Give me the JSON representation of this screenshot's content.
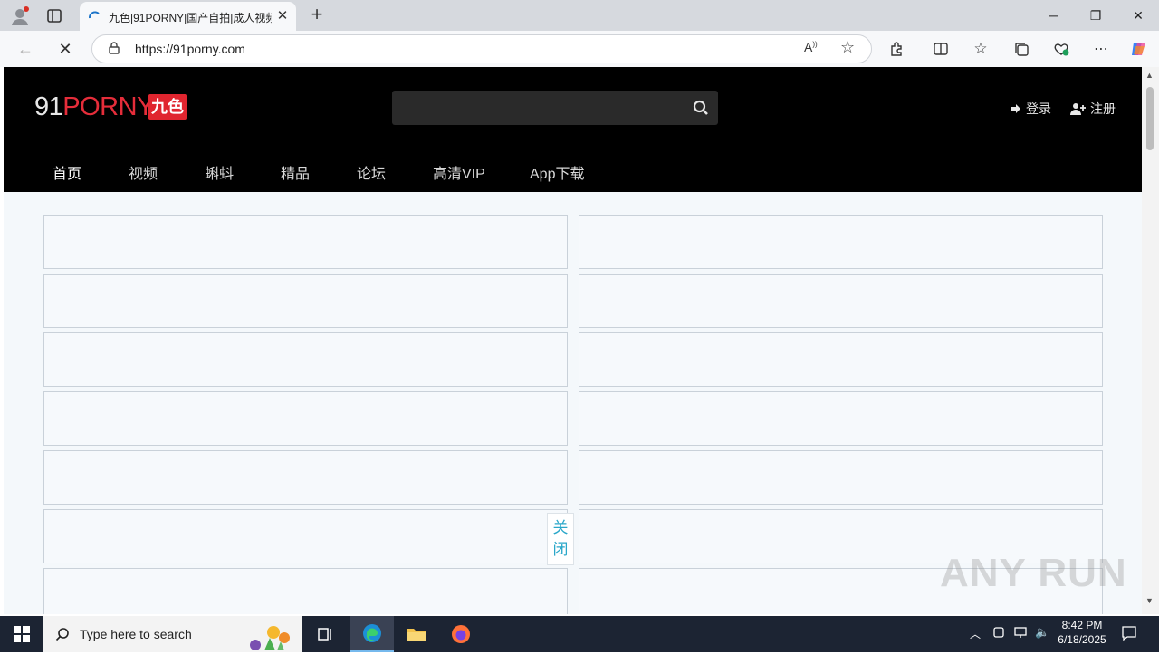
{
  "browser": {
    "tab_title": "九色|91PORNY|国产自拍|成人视频",
    "url": "https://91porny.com"
  },
  "site": {
    "logo_prefix": "91",
    "logo_main": "PORNY",
    "logo_badge": "九色",
    "search_placeholder": "",
    "login_label": "登录",
    "register_label": "注册",
    "nav": [
      "首页",
      "视频",
      "蝌蚪",
      "精品",
      "论坛",
      "高清VIP",
      "App下载"
    ],
    "close_label_1": "关",
    "close_label_2": "闭",
    "colors": {
      "brand_red": "#e0252f",
      "header_bg": "#000000",
      "close_text": "#2aa7c9"
    }
  },
  "watermark": "ANY RUN",
  "taskbar": {
    "search_placeholder": "Type here to search",
    "time": "8:42 PM",
    "date": "6/18/2025"
  }
}
